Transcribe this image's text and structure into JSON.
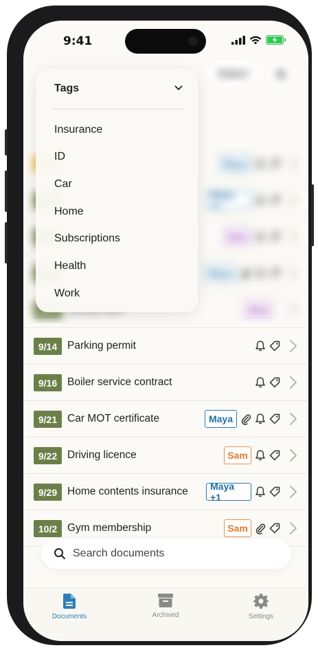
{
  "status_bar": {
    "time": "9:41"
  },
  "header": {
    "select_label": "Select",
    "add_label": "+"
  },
  "tags_menu": {
    "header_label": "Tags",
    "items": [
      "Insurance",
      "ID",
      "Car",
      "Home",
      "Subscriptions",
      "Health",
      "Work"
    ]
  },
  "documents": [
    {
      "date": "",
      "title": "",
      "assignee": "Maya",
      "assignee_type": "maya",
      "has_attachment": false,
      "has_bell": true,
      "has_tag": true,
      "date_color": "orange"
    },
    {
      "date": "",
      "title": "",
      "assignee": "Maya +1",
      "assignee_type": "maya",
      "has_attachment": false,
      "has_bell": true,
      "has_tag": true
    },
    {
      "date": "",
      "title": "",
      "assignee": "Alex",
      "assignee_type": "alex",
      "has_attachment": false,
      "has_bell": true,
      "has_tag": true
    },
    {
      "date": "",
      "title": "",
      "assignee": "Maya",
      "assignee_type": "maya",
      "has_attachment": true,
      "has_bell": true,
      "has_tag": true
    },
    {
      "date": "9/11",
      "title": "Library card",
      "assignee": "Alex",
      "assignee_type": "alex",
      "has_attachment": false,
      "has_bell": false,
      "has_tag": false
    },
    {
      "date": "9/14",
      "title": "Parking permit",
      "assignee": "",
      "has_attachment": false,
      "has_bell": true,
      "has_tag": true
    },
    {
      "date": "9/16",
      "title": "Boiler service contract",
      "assignee": "",
      "has_attachment": false,
      "has_bell": true,
      "has_tag": true
    },
    {
      "date": "9/21",
      "title": "Car MOT certificate",
      "assignee": "Maya",
      "assignee_type": "maya",
      "has_attachment": true,
      "has_bell": true,
      "has_tag": true
    },
    {
      "date": "9/22",
      "title": "Driving licence",
      "assignee": "Sam",
      "assignee_type": "sam",
      "has_attachment": false,
      "has_bell": true,
      "has_tag": true
    },
    {
      "date": "9/29",
      "title": "Home contents insurance",
      "assignee": "Maya +1",
      "assignee_type": "maya",
      "has_attachment": false,
      "has_bell": true,
      "has_tag": true
    },
    {
      "date": "10/2",
      "title": "Gym membership",
      "assignee": "Sam",
      "assignee_type": "sam",
      "has_attachment": true,
      "has_bell": false,
      "has_tag": true
    }
  ],
  "search": {
    "placeholder": "Search documents"
  },
  "tabs": [
    {
      "label": "Documents",
      "active": true,
      "icon": "document-icon"
    },
    {
      "label": "Archived",
      "active": false,
      "icon": "archive-box-icon"
    },
    {
      "label": "Settings",
      "active": false,
      "icon": "gear-icon"
    }
  ],
  "colors": {
    "date_green": "#6b8048",
    "date_orange": "#f2b233",
    "maya": "#2a79b4",
    "alex": "#9b35b8",
    "sam": "#e9924a",
    "active_tab": "#2f7fb6"
  }
}
